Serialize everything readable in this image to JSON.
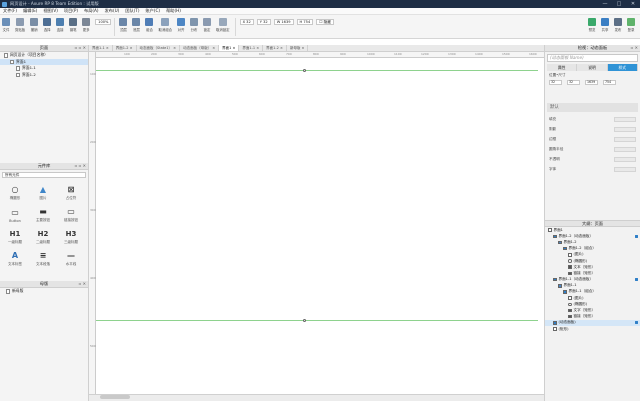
{
  "window": {
    "title": "网页设计 - Axure RP 8 Team Edition : 试用版",
    "controls": [
      "—",
      "□",
      "✕"
    ]
  },
  "menu": [
    "文件(F)",
    "编辑(E)",
    "视图(V)",
    "项目(P)",
    "布局(A)",
    "发布(U)",
    "团队(T)",
    "账户(C)",
    "帮助(H)"
  ],
  "toolbar": {
    "tools": [
      {
        "label": "文件",
        "icon": "file-icon",
        "color": "#6b8fb8"
      },
      {
        "label": "剪贴板",
        "icon": "clipboard-icon",
        "color": "#8b9bb0"
      },
      {
        "label": "撤销",
        "icon": "undo-icon",
        "color": "#7a8ea6"
      },
      {
        "label": "选择",
        "icon": "select-icon",
        "color": "#4d6e94"
      },
      {
        "label": "连接",
        "icon": "connect-icon",
        "color": "#4d7fb0"
      },
      {
        "label": "钢笔",
        "icon": "pen-icon",
        "color": "#5a6f86"
      },
      {
        "label": "更多",
        "icon": "more-icon",
        "color": "#7c8796"
      }
    ],
    "zoom": "100%",
    "tools2": [
      {
        "label": "顶层",
        "icon": "top-layer-icon",
        "color": "#6a86a8"
      },
      {
        "label": "底层",
        "icon": "bottom-layer-icon",
        "color": "#6a86a8"
      },
      {
        "label": "组合",
        "icon": "group-icon",
        "color": "#4f7db6"
      },
      {
        "label": "取消组合",
        "icon": "ungroup-icon",
        "color": "#8ca2bc"
      },
      {
        "label": "对齐",
        "icon": "align-icon",
        "color": "#4d86c4"
      },
      {
        "label": "分布",
        "icon": "distribute-icon",
        "color": "#7f95ad"
      },
      {
        "label": "锁定",
        "icon": "lock-icon",
        "color": "#8a9ab0"
      },
      {
        "label": "取消锁定",
        "icon": "unlock-icon",
        "color": "#98a8bb"
      }
    ],
    "fields": [
      "X 32",
      "Y 32",
      "W 1639",
      "H 754"
    ],
    "hidden_label": "隐藏",
    "right_tools": [
      {
        "label": "预览",
        "icon": "preview-icon",
        "color": "#3aa96b"
      },
      {
        "label": "共享",
        "icon": "share-icon",
        "color": "#3b7fc4"
      },
      {
        "label": "发布",
        "icon": "publish-icon",
        "color": "#5c6f86"
      },
      {
        "label": "登录",
        "icon": "login-icon",
        "color": "#5fb36b"
      }
    ]
  },
  "pages_panel": {
    "title": "页面",
    "items": [
      {
        "label": "网页设计（项目名称）",
        "level": 0,
        "selected": false
      },
      {
        "label": "界面1",
        "level": 1,
        "selected": true
      },
      {
        "label": "界面1-1",
        "level": 2,
        "selected": false
      },
      {
        "label": "界面1-2",
        "level": 2,
        "selected": false
      }
    ]
  },
  "library_panel": {
    "title": "元件库",
    "select": "所有元件",
    "widgets": [
      {
        "label": "椭圆形",
        "glyph": "○"
      },
      {
        "label": "图片",
        "glyph": "▲"
      },
      {
        "label": "占位符",
        "glyph": "⊠"
      },
      {
        "label": "Button",
        "glyph": "▭"
      },
      {
        "label": "主要按钮",
        "glyph": "▬"
      },
      {
        "label": "链接按钮",
        "glyph": "▭"
      },
      {
        "label": "一级标题",
        "glyph": "H1"
      },
      {
        "label": "二级标题",
        "glyph": "H2"
      },
      {
        "label": "三级标题",
        "glyph": "H3"
      },
      {
        "label": "文本标签",
        "glyph": "A"
      },
      {
        "label": "文本段落",
        "glyph": "≡"
      },
      {
        "label": "水平线",
        "glyph": "—"
      }
    ]
  },
  "masters_panel": {
    "title": "母版",
    "item": "新母版"
  },
  "tabs": [
    "界面1-1",
    "界面1-2",
    "动态面板（State1）",
    "动态面板（母版）",
    "界面1",
    "界面1-1",
    "界面1-2",
    "新母版"
  ],
  "active_tab_index": 4,
  "ruler": {
    "top": [
      "100",
      "200",
      "300",
      "400",
      "500",
      "600",
      "700",
      "800",
      "900",
      "1000",
      "1100",
      "1200",
      "1300",
      "1400",
      "1500",
      "1600"
    ],
    "left": [
      "100",
      "200",
      "300",
      "400",
      "500"
    ]
  },
  "inspector": {
    "title": "检视：动态面板",
    "name_placeholder": "(动态面板 Name)",
    "tabs": [
      "属性",
      "说明",
      "样式"
    ],
    "active_tab_index": 2,
    "position_label": "位置•尺寸",
    "values": [
      "32",
      "32",
      "1639",
      "754"
    ],
    "style_label": "默认",
    "rows": [
      "填充",
      "阴影",
      "边框",
      "圆角半径",
      "不透明",
      "字体"
    ]
  },
  "outline": {
    "title": "大纲：页面",
    "items": [
      {
        "label": "界面1",
        "level": 0,
        "icon": "page",
        "sel": false
      },
      {
        "label": "界面1-2（动态面板）",
        "level": 1,
        "icon": "panel",
        "sel": false
      },
      {
        "label": "界面1-2",
        "level": 2,
        "icon": "state",
        "sel": false
      },
      {
        "label": "界面1-2（组合）",
        "level": 3,
        "icon": "group",
        "sel": false
      },
      {
        "label": "(图片)",
        "level": 4,
        "icon": "image",
        "sel": false
      },
      {
        "label": "(椭圆形)",
        "level": 4,
        "icon": "circle",
        "sel": false
      },
      {
        "label": "文本（矩形）",
        "level": 4,
        "icon": "text",
        "sel": false
      },
      {
        "label": "链接（矩形）",
        "level": 4,
        "icon": "link",
        "sel": false
      },
      {
        "label": "界面1-1（动态面板）",
        "level": 1,
        "icon": "panel",
        "sel": false
      },
      {
        "label": "界面1-1",
        "level": 2,
        "icon": "state",
        "sel": false
      },
      {
        "label": "界面1-1（组合）",
        "level": 3,
        "icon": "group",
        "sel": false
      },
      {
        "label": "(图片)",
        "level": 4,
        "icon": "image",
        "sel": false
      },
      {
        "label": "(椭圆形)",
        "level": 4,
        "icon": "circle",
        "sel": false
      },
      {
        "label": "文字（矩形）",
        "level": 4,
        "icon": "text",
        "sel": false
      },
      {
        "label": "链接（矩形）",
        "level": 4,
        "icon": "link",
        "sel": false
      },
      {
        "label": "(动态面板)",
        "level": 1,
        "icon": "panel",
        "sel": true
      },
      {
        "label": "(矩形)",
        "level": 1,
        "icon": "rect",
        "sel": false
      }
    ]
  }
}
